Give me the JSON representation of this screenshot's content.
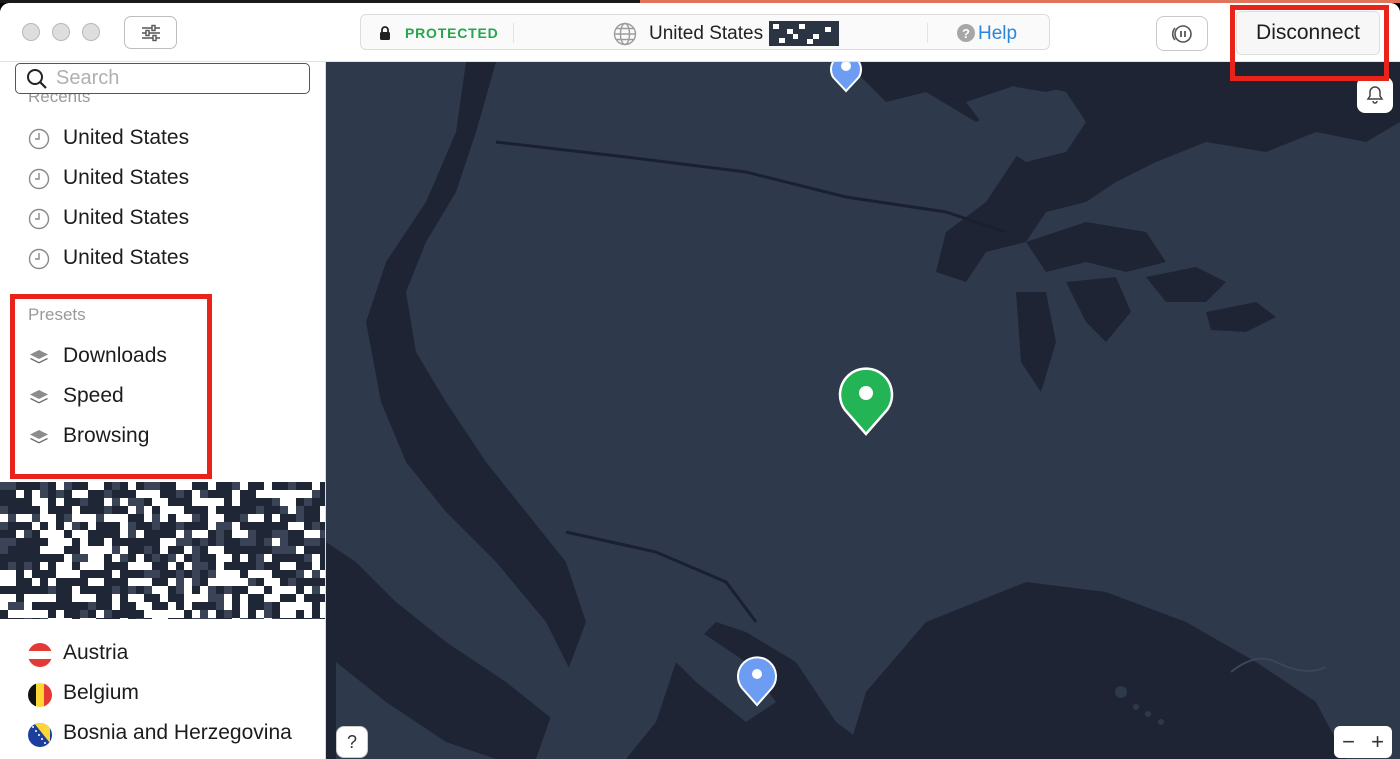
{
  "titlebar": {
    "status": "PROTECTED",
    "country": "United States",
    "help": "Help",
    "disconnect": "Disconnect"
  },
  "sidebar": {
    "search_placeholder": "Search",
    "recents_title": "Recents",
    "recents": [
      "United States",
      "United States",
      "United States",
      "United States"
    ],
    "presets_title": "Presets",
    "presets": [
      "Downloads",
      "Speed",
      "Browsing"
    ],
    "countries": [
      "Austria",
      "Belgium",
      "Bosnia and Herzegovina"
    ]
  },
  "map": {
    "help_button": "?",
    "zoom_out": "−",
    "zoom_in": "+"
  },
  "colors": {
    "protected_green": "#21a84a",
    "highlight_red": "#e8231a",
    "map_background": "#1e2433",
    "land": "#2e3a4b",
    "active_pin": "#22b455",
    "server_pin": "#6d9df2"
  }
}
